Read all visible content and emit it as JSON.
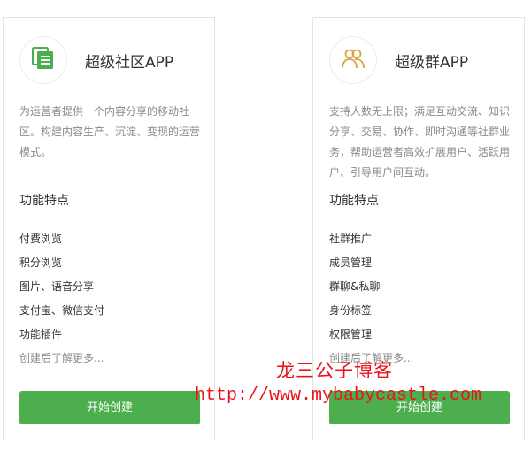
{
  "cards": [
    {
      "title": "超级社区APP",
      "icon": "document-stack-icon",
      "icon_color": "#4cae4c",
      "description": "为运营者提供一个内容分享的移动社区。构建内容生产、沉淀、变现的运营模式。",
      "features_title": "功能特点",
      "features": [
        "付费浏览",
        "积分浏览",
        "图片、语音分享",
        "支付宝、微信支付",
        "功能插件"
      ],
      "more": "创建后了解更多...",
      "button_label": "开始创建"
    },
    {
      "title": "超级群APP",
      "icon": "users-group-icon",
      "icon_color": "#d9a441",
      "description": "支持人数无上限；满足互动交流、知识分享、交易、协作、即时沟通等社群业务，帮助运营者高效扩展用户、活跃用户、引导用户间互动。",
      "features_title": "功能特点",
      "features": [
        "社群推广",
        "成员管理",
        "群聊&私聊",
        "身份标签",
        "权限管理"
      ],
      "more": "创建后了解更多...",
      "button_label": "开始创建"
    }
  ],
  "watermark": {
    "line1": "龙三公子博客",
    "line2": "http://www.mybabycastle.com"
  },
  "colors": {
    "button": "#4cae4c",
    "watermark": "#e8141a"
  }
}
